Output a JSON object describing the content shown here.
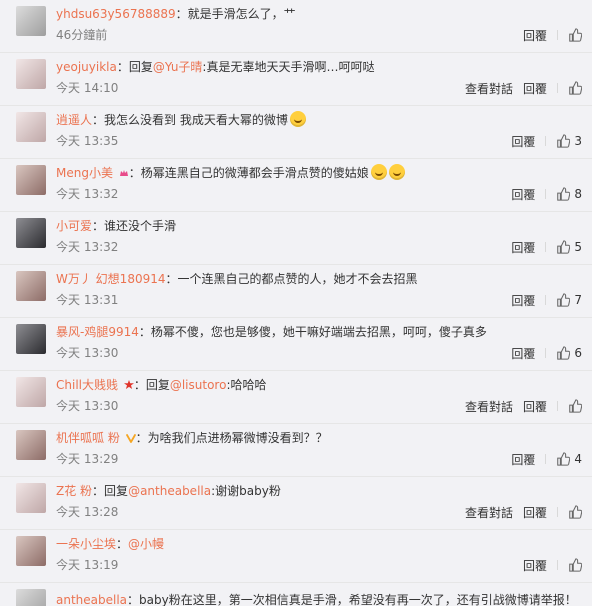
{
  "actions": {
    "reply": "回覆",
    "view_conversation": "查看對話"
  },
  "comments": [
    {
      "name": "yhdsu63y56788889",
      "text": "：就是手滑怎么了，艹",
      "time": "46分鐘前",
      "show_view": false,
      "likes": ""
    },
    {
      "name": "yeojuyikla",
      "text": "：回复",
      "mention": "@Yu子晴",
      "text2": ":真是无辜地天天手滑啊…呵呵哒",
      "time": "今天 14:10",
      "show_view": true,
      "likes": ""
    },
    {
      "name": "逍遥人",
      "text": "：我怎么没看到 我成天看大幂的微博",
      "time": "今天 13:35",
      "show_view": false,
      "likes": "3"
    },
    {
      "name": "Meng小美",
      "text": "：杨幂连黑自己的微薄都会手滑点赞的傻姑娘",
      "time": "今天 13:32",
      "show_view": false,
      "likes": "8"
    },
    {
      "name": "小可爱",
      "text": "：谁还没个手滑",
      "time": "今天 13:32",
      "show_view": false,
      "likes": "5"
    },
    {
      "name": "W万丿 幻想180914",
      "text": "：一个连黑自己的都点赞的人，她才不会去招黑",
      "time": "今天 13:31",
      "show_view": false,
      "likes": "7"
    },
    {
      "name": "暴风-鸡腿9914",
      "text": "：杨幂不傻，您也是够傻，她干嘛好端端去招黑，呵呵，傻子真多",
      "time": "今天 13:30",
      "show_view": false,
      "likes": "6"
    },
    {
      "name": "Chill大贱贱",
      "text": "：回复",
      "mention": "@lisutoro",
      "text2": ":哈哈哈",
      "time": "今天 13:30",
      "show_view": true,
      "likes": ""
    },
    {
      "name": "机伴呱呱 粉",
      "text": "：为啥我们点进杨幂微博没看到？？",
      "time": "今天 13:29",
      "show_view": false,
      "likes": "4"
    },
    {
      "name": "Z花 粉",
      "text": "：回复",
      "mention": "@antheabella",
      "text2": ":谢谢baby粉",
      "time": "今天 13:28",
      "show_view": true,
      "likes": ""
    },
    {
      "name": "一朵小尘埃",
      "text": "：",
      "mention": "@小幔",
      "text2": "",
      "time": "今天 13:19",
      "show_view": false,
      "likes": ""
    },
    {
      "name": "antheabella",
      "text": "：baby粉在这里，第一次相信真是手滑，希望没有再一次了，还有引战微博请举报！",
      "time": "",
      "show_view": false,
      "likes": ""
    }
  ]
}
